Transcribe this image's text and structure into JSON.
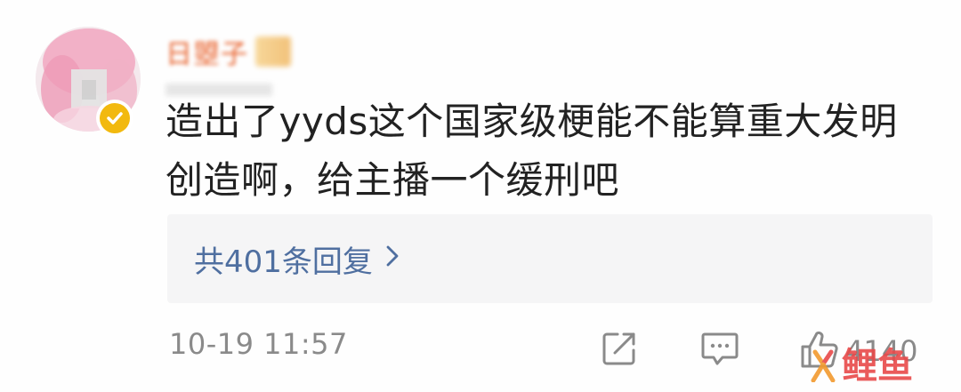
{
  "user": {
    "name": "日曌子",
    "verified": true
  },
  "comment": {
    "line1": "造出了yyds这个国家级梗能不能算重大发明",
    "line2": "创造啊，给主播一个缓刑吧"
  },
  "replies": {
    "label": "共401条回复",
    "chevron": "›"
  },
  "footer": {
    "timestamp": "10-19 11:57",
    "like_count": "4140"
  },
  "icons": {
    "share": "share-icon",
    "comment": "comment-icon",
    "like": "thumbs-up-icon"
  },
  "watermark": {
    "text": "鲤鱼"
  },
  "colors": {
    "link": "#4f6fa0",
    "meta": "#8a8a8a",
    "username": "#e8612b",
    "verified": "#f2b90f",
    "watermark": "#e84a4a"
  }
}
